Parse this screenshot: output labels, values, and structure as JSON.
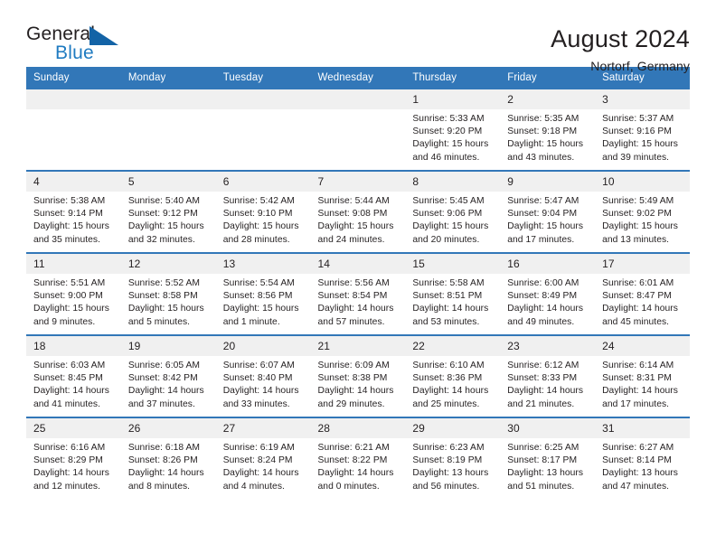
{
  "logo": {
    "word_one": "General",
    "word_two": "Blue",
    "mark": "blue-triangle"
  },
  "header": {
    "title": "August 2024",
    "location": "Nortorf, Germany"
  },
  "weekday_headers": [
    "Sunday",
    "Monday",
    "Tuesday",
    "Wednesday",
    "Thursday",
    "Friday",
    "Saturday"
  ],
  "labels": {
    "sunrise": "Sunrise:",
    "sunset": "Sunset:",
    "daylight": "Daylight:"
  },
  "colors": {
    "header_blue": "#3277b8",
    "logo_blue": "#1363a6",
    "logo_text_blue": "#1f7bc1",
    "daynum_gray": "#f0f0f0",
    "text": "#231f20"
  },
  "weeks": [
    [
      {
        "day": "",
        "empty": true
      },
      {
        "day": "",
        "empty": true
      },
      {
        "day": "",
        "empty": true
      },
      {
        "day": "",
        "empty": true
      },
      {
        "day": "1",
        "sunrise": "Sunrise: 5:33 AM",
        "sunset": "Sunset: 9:20 PM",
        "daylight": "Daylight: 15 hours and 46 minutes."
      },
      {
        "day": "2",
        "sunrise": "Sunrise: 5:35 AM",
        "sunset": "Sunset: 9:18 PM",
        "daylight": "Daylight: 15 hours and 43 minutes."
      },
      {
        "day": "3",
        "sunrise": "Sunrise: 5:37 AM",
        "sunset": "Sunset: 9:16 PM",
        "daylight": "Daylight: 15 hours and 39 minutes."
      }
    ],
    [
      {
        "day": "4",
        "sunrise": "Sunrise: 5:38 AM",
        "sunset": "Sunset: 9:14 PM",
        "daylight": "Daylight: 15 hours and 35 minutes."
      },
      {
        "day": "5",
        "sunrise": "Sunrise: 5:40 AM",
        "sunset": "Sunset: 9:12 PM",
        "daylight": "Daylight: 15 hours and 32 minutes."
      },
      {
        "day": "6",
        "sunrise": "Sunrise: 5:42 AM",
        "sunset": "Sunset: 9:10 PM",
        "daylight": "Daylight: 15 hours and 28 minutes."
      },
      {
        "day": "7",
        "sunrise": "Sunrise: 5:44 AM",
        "sunset": "Sunset: 9:08 PM",
        "daylight": "Daylight: 15 hours and 24 minutes."
      },
      {
        "day": "8",
        "sunrise": "Sunrise: 5:45 AM",
        "sunset": "Sunset: 9:06 PM",
        "daylight": "Daylight: 15 hours and 20 minutes."
      },
      {
        "day": "9",
        "sunrise": "Sunrise: 5:47 AM",
        "sunset": "Sunset: 9:04 PM",
        "daylight": "Daylight: 15 hours and 17 minutes."
      },
      {
        "day": "10",
        "sunrise": "Sunrise: 5:49 AM",
        "sunset": "Sunset: 9:02 PM",
        "daylight": "Daylight: 15 hours and 13 minutes."
      }
    ],
    [
      {
        "day": "11",
        "sunrise": "Sunrise: 5:51 AM",
        "sunset": "Sunset: 9:00 PM",
        "daylight": "Daylight: 15 hours and 9 minutes."
      },
      {
        "day": "12",
        "sunrise": "Sunrise: 5:52 AM",
        "sunset": "Sunset: 8:58 PM",
        "daylight": "Daylight: 15 hours and 5 minutes."
      },
      {
        "day": "13",
        "sunrise": "Sunrise: 5:54 AM",
        "sunset": "Sunset: 8:56 PM",
        "daylight": "Daylight: 15 hours and 1 minute."
      },
      {
        "day": "14",
        "sunrise": "Sunrise: 5:56 AM",
        "sunset": "Sunset: 8:54 PM",
        "daylight": "Daylight: 14 hours and 57 minutes."
      },
      {
        "day": "15",
        "sunrise": "Sunrise: 5:58 AM",
        "sunset": "Sunset: 8:51 PM",
        "daylight": "Daylight: 14 hours and 53 minutes."
      },
      {
        "day": "16",
        "sunrise": "Sunrise: 6:00 AM",
        "sunset": "Sunset: 8:49 PM",
        "daylight": "Daylight: 14 hours and 49 minutes."
      },
      {
        "day": "17",
        "sunrise": "Sunrise: 6:01 AM",
        "sunset": "Sunset: 8:47 PM",
        "daylight": "Daylight: 14 hours and 45 minutes."
      }
    ],
    [
      {
        "day": "18",
        "sunrise": "Sunrise: 6:03 AM",
        "sunset": "Sunset: 8:45 PM",
        "daylight": "Daylight: 14 hours and 41 minutes."
      },
      {
        "day": "19",
        "sunrise": "Sunrise: 6:05 AM",
        "sunset": "Sunset: 8:42 PM",
        "daylight": "Daylight: 14 hours and 37 minutes."
      },
      {
        "day": "20",
        "sunrise": "Sunrise: 6:07 AM",
        "sunset": "Sunset: 8:40 PM",
        "daylight": "Daylight: 14 hours and 33 minutes."
      },
      {
        "day": "21",
        "sunrise": "Sunrise: 6:09 AM",
        "sunset": "Sunset: 8:38 PM",
        "daylight": "Daylight: 14 hours and 29 minutes."
      },
      {
        "day": "22",
        "sunrise": "Sunrise: 6:10 AM",
        "sunset": "Sunset: 8:36 PM",
        "daylight": "Daylight: 14 hours and 25 minutes."
      },
      {
        "day": "23",
        "sunrise": "Sunrise: 6:12 AM",
        "sunset": "Sunset: 8:33 PM",
        "daylight": "Daylight: 14 hours and 21 minutes."
      },
      {
        "day": "24",
        "sunrise": "Sunrise: 6:14 AM",
        "sunset": "Sunset: 8:31 PM",
        "daylight": "Daylight: 14 hours and 17 minutes."
      }
    ],
    [
      {
        "day": "25",
        "sunrise": "Sunrise: 6:16 AM",
        "sunset": "Sunset: 8:29 PM",
        "daylight": "Daylight: 14 hours and 12 minutes."
      },
      {
        "day": "26",
        "sunrise": "Sunrise: 6:18 AM",
        "sunset": "Sunset: 8:26 PM",
        "daylight": "Daylight: 14 hours and 8 minutes."
      },
      {
        "day": "27",
        "sunrise": "Sunrise: 6:19 AM",
        "sunset": "Sunset: 8:24 PM",
        "daylight": "Daylight: 14 hours and 4 minutes."
      },
      {
        "day": "28",
        "sunrise": "Sunrise: 6:21 AM",
        "sunset": "Sunset: 8:22 PM",
        "daylight": "Daylight: 14 hours and 0 minutes."
      },
      {
        "day": "29",
        "sunrise": "Sunrise: 6:23 AM",
        "sunset": "Sunset: 8:19 PM",
        "daylight": "Daylight: 13 hours and 56 minutes."
      },
      {
        "day": "30",
        "sunrise": "Sunrise: 6:25 AM",
        "sunset": "Sunset: 8:17 PM",
        "daylight": "Daylight: 13 hours and 51 minutes."
      },
      {
        "day": "31",
        "sunrise": "Sunrise: 6:27 AM",
        "sunset": "Sunset: 8:14 PM",
        "daylight": "Daylight: 13 hours and 47 minutes."
      }
    ]
  ]
}
